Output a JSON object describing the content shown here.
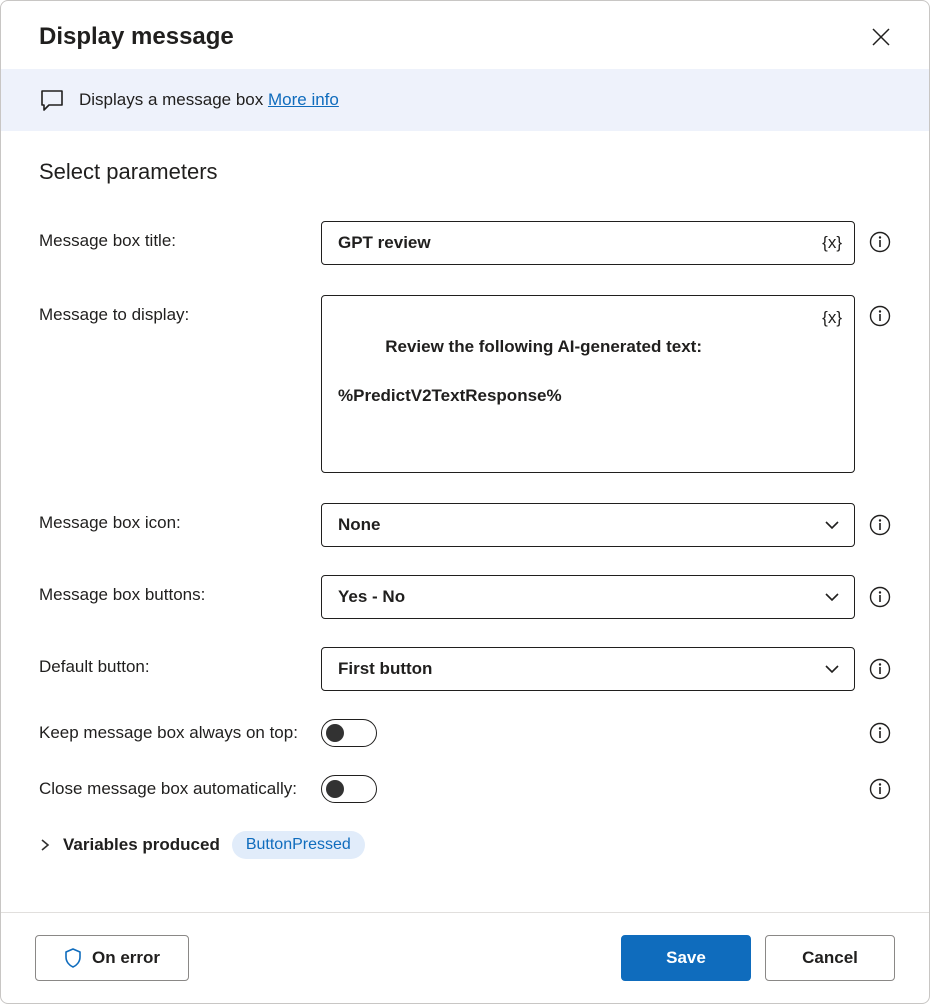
{
  "title": "Display message",
  "banner": {
    "description": "Displays a message box ",
    "link_text": "More info"
  },
  "section_title": "Select parameters",
  "fields": {
    "title_label": "Message box title:",
    "title_value": "GPT review",
    "message_label": "Message to display:",
    "message_value": "Review the following AI-generated text:\n\n%PredictV2TextResponse%",
    "icon_label": "Message box icon:",
    "icon_value": "None",
    "buttons_label": "Message box buttons:",
    "buttons_value": "Yes - No",
    "default_label": "Default button:",
    "default_value": "First button",
    "ontop_label": "Keep message box always on top:",
    "ontop_value": false,
    "autoclose_label": "Close message box automatically:",
    "autoclose_value": false
  },
  "variables": {
    "label": "Variables produced",
    "chip": "ButtonPressed"
  },
  "footer": {
    "on_error": "On error",
    "save": "Save",
    "cancel": "Cancel"
  }
}
